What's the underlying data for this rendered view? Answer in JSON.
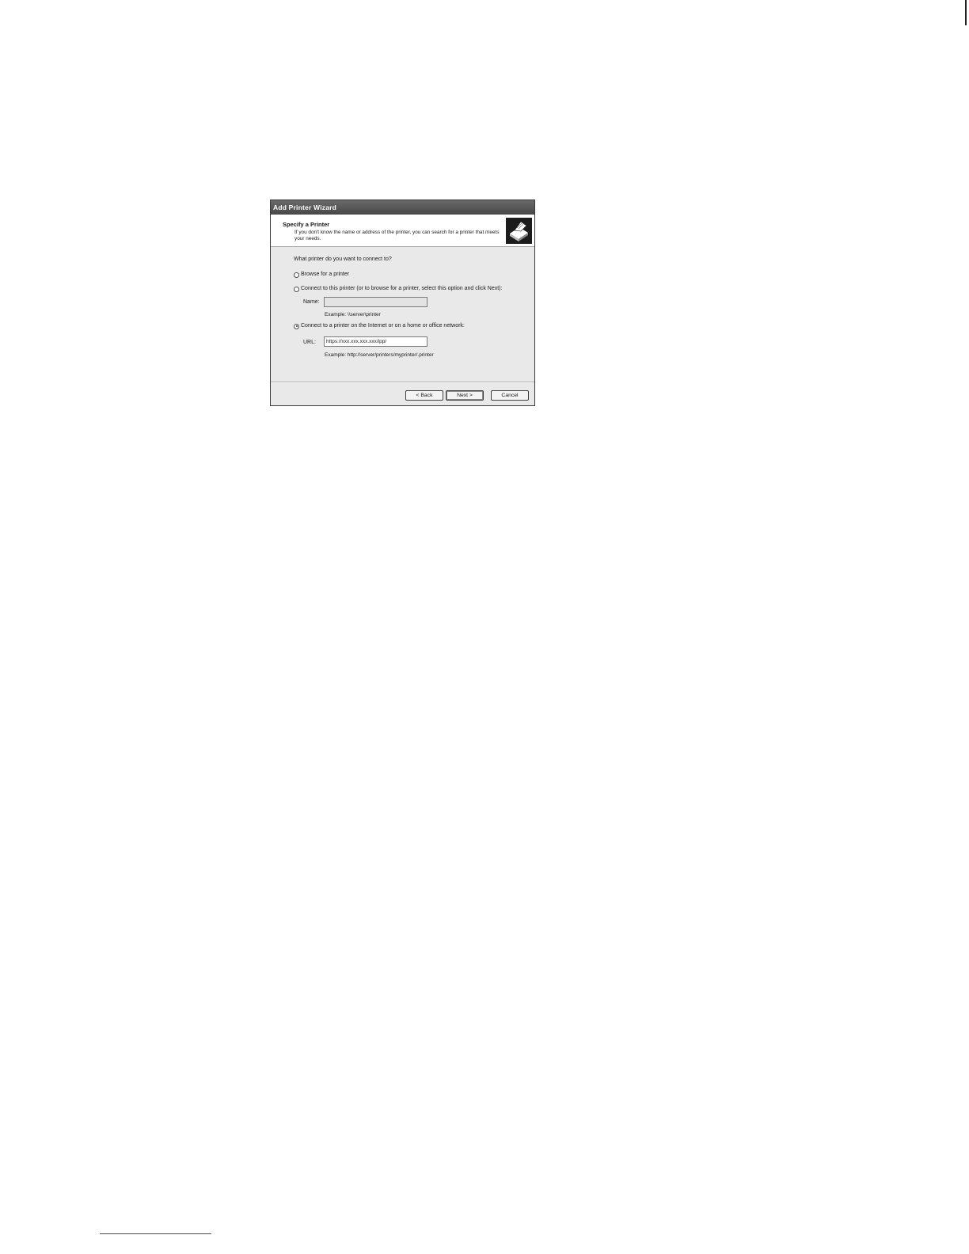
{
  "window": {
    "title": "Add Printer Wizard"
  },
  "header": {
    "title": "Specify a Printer",
    "description": "If you don't know the name or address of the printer, you can search for a printer that meets your needs.",
    "icon": "printer-icon"
  },
  "main": {
    "question": "What printer do you want to connect to?",
    "options": [
      {
        "label": "Browse for a printer",
        "checked": false
      },
      {
        "label": "Connect to this printer (or to browse for a printer, select this option and click Next):",
        "checked": false
      },
      {
        "label": "Connect to a printer on the Internet or on a home or office network:",
        "checked": true
      }
    ],
    "name_field": {
      "label": "Name:",
      "value": "",
      "example": "Example: \\\\server\\printer"
    },
    "url_field": {
      "label": "URL:",
      "value": "https://xxx.xxx.xxx.xxx/ipp/",
      "example": "Example: http://server/printers/myprinter/.printer"
    }
  },
  "buttons": {
    "back": "< Back",
    "next": "Next >",
    "cancel": "Cancel"
  }
}
